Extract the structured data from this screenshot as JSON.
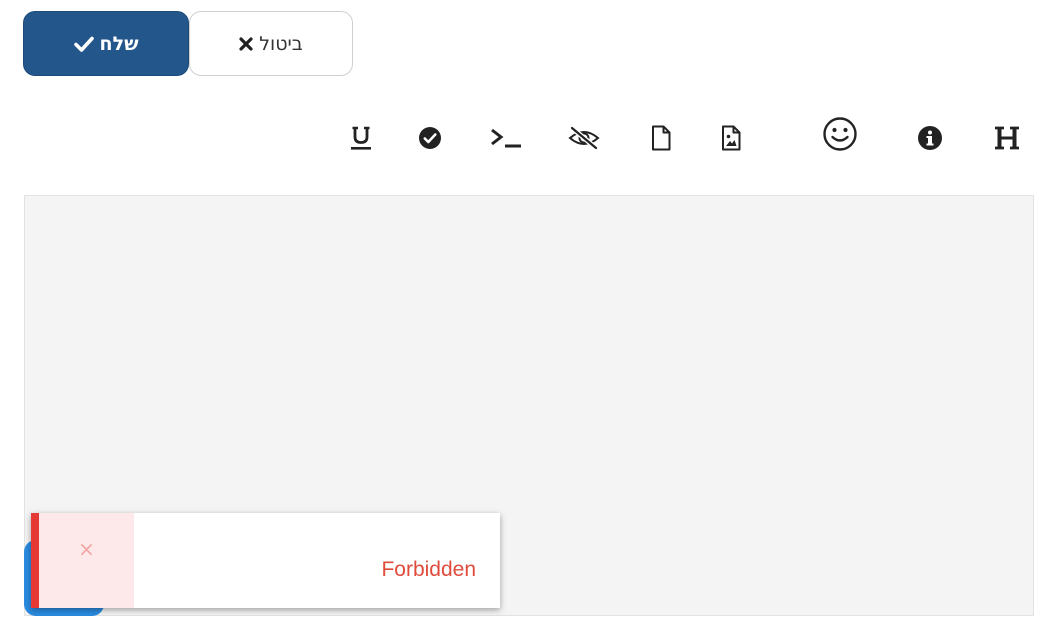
{
  "actions": {
    "send_label": "שלח",
    "cancel_label": "ביטול"
  },
  "toolbar": {
    "items": [
      {
        "name": "underline",
        "icon": "underline-icon"
      },
      {
        "name": "check-circle",
        "icon": "check-circle-icon"
      },
      {
        "name": "code",
        "icon": "terminal-icon"
      },
      {
        "name": "spoiler",
        "icon": "eye-slash-icon"
      },
      {
        "name": "file",
        "icon": "file-icon"
      },
      {
        "name": "image-file",
        "icon": "file-image-icon"
      },
      {
        "name": "emoji",
        "icon": "smile-icon"
      },
      {
        "name": "info",
        "icon": "info-circle-icon"
      },
      {
        "name": "heading",
        "icon": "heading-icon"
      }
    ]
  },
  "editor": {
    "value": ""
  },
  "toast": {
    "message": "Forbidden",
    "close_symbol": "×",
    "accent_color": "#e53935"
  },
  "colors": {
    "primary": "#23578b",
    "error": "#e04b3c"
  }
}
